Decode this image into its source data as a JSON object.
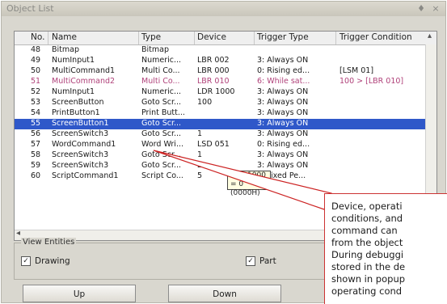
{
  "window": {
    "title": "Object List",
    "pin_glyph": "♦",
    "close_glyph": "×"
  },
  "grid": {
    "columns": [
      "No.",
      "Name",
      "Type",
      "Device",
      "Trigger Type",
      "Trigger Condition"
    ],
    "rows": [
      {
        "no": "48",
        "name": "Bitmap",
        "type": "Bitmap",
        "device": "",
        "trigger": "",
        "condition": "",
        "style": ""
      },
      {
        "no": "49",
        "name": "NumInput1",
        "type": "Numeric...",
        "device": "LBR 002",
        "trigger": "3: Always ON",
        "condition": "",
        "style": ""
      },
      {
        "no": "50",
        "name": "MultiCommand1",
        "type": "Multi Co...",
        "device": "LBR 000",
        "trigger": "0: Rising ed...",
        "condition": "[LSM 01]",
        "style": ""
      },
      {
        "no": "51",
        "name": "MultiCommand2",
        "type": "Multi Co...",
        "device": "LBR 010",
        "trigger": "6: While sat...",
        "condition": "100 > [LBR 010]",
        "style": "pink"
      },
      {
        "no": "52",
        "name": "NumInput1",
        "type": "Numeric...",
        "device": "LDR 1000",
        "trigger": "3: Always ON",
        "condition": "",
        "style": ""
      },
      {
        "no": "53",
        "name": "ScreenButton",
        "type": "Goto Scr...",
        "device": "100",
        "trigger": "3: Always ON",
        "condition": "",
        "style": ""
      },
      {
        "no": "54",
        "name": "PrintButton1",
        "type": "Print Butt...",
        "device": "",
        "trigger": "3: Always ON",
        "condition": "",
        "style": ""
      },
      {
        "no": "55",
        "name": "ScreenButton1",
        "type": "Goto Scr...",
        "device": "",
        "trigger": "3: Always ON",
        "condition": "",
        "style": "sel"
      },
      {
        "no": "56",
        "name": "ScreenSwitch3",
        "type": "Goto Scr...",
        "device": "1",
        "trigger": "3: Always ON",
        "condition": "",
        "style": ""
      },
      {
        "no": "57",
        "name": "WordCommand1",
        "type": "Word Wri...",
        "device": "LSD 051",
        "trigger": "0: Rising ed...",
        "condition": "",
        "style": ""
      },
      {
        "no": "58",
        "name": "ScreenSwitch3",
        "type": "Goto Scr...",
        "device": "1",
        "trigger": "3: Always ON",
        "condition": "",
        "style": ""
      },
      {
        "no": "59",
        "name": "ScreenSwitch3",
        "type": "Goto Scr...",
        "device": "2",
        "trigger": "3: Always ON",
        "condition": "",
        "style": ""
      },
      {
        "no": "60",
        "name": "ScriptCommand1",
        "type": "Script Co...",
        "device": "5",
        "trigger": "7: Fixed Pe...",
        "condition": "",
        "style": ""
      }
    ]
  },
  "tooltip": {
    "line1": "LDR 1000 = 0",
    "line2": "(0000H)"
  },
  "view_entities": {
    "legend": "View Entities",
    "drawing": {
      "label": "Drawing",
      "checked": true
    },
    "part": {
      "label": "Part",
      "checked": true
    }
  },
  "buttons": {
    "up": "Up",
    "down": "Down"
  },
  "callout_note": {
    "lines": [
      "Device, operati",
      "conditions, and",
      "command can",
      "from the object",
      "During debuggi",
      "stored in the de",
      "shown in popup",
      "operating cond"
    ]
  },
  "colors": {
    "selection": "#2f58c9",
    "pink_row": "#b0427a",
    "callout": "#cc2222",
    "tooltip_bg": "#ffffe1"
  },
  "icons": {
    "check": "✓",
    "scroll_left": "◂",
    "scroll_up": "▴"
  }
}
